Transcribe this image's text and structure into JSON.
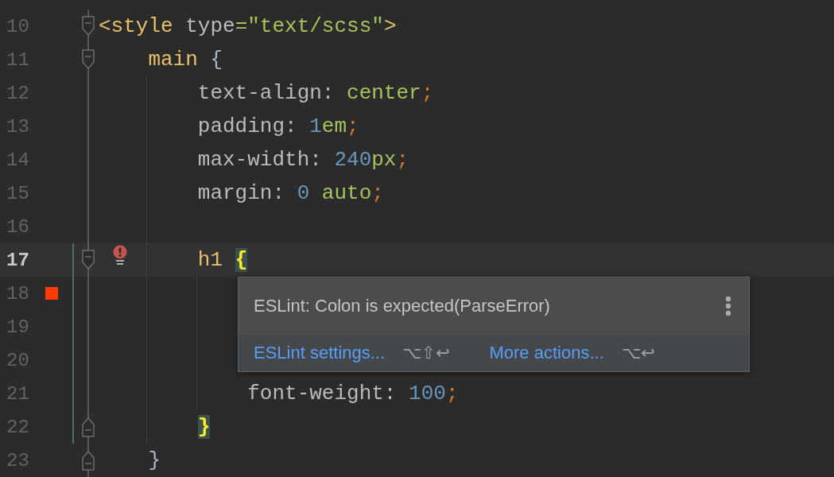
{
  "editor": {
    "lines": [
      {
        "number": "10",
        "fold_start": true,
        "tokens": [
          {
            "text": "<style",
            "kind": "tag"
          },
          {
            "text": " type",
            "kind": "attr"
          },
          {
            "text": "=\"text/scss\"",
            "kind": "string"
          },
          {
            "text": ">",
            "kind": "tag"
          }
        ],
        "children": [
          {
            "number": "11",
            "fold_start": true,
            "tokens": [
              {
                "text": "main",
                "kind": "selector"
              },
              {
                "text": " {",
                "kind": "punct"
              }
            ],
            "children": [
              {
                "number": "12",
                "tokens": [
                  {
                    "text": "text-align: ",
                    "kind": "property"
                  },
                  {
                    "text": "center",
                    "kind": "value"
                  },
                  {
                    "text": ";",
                    "kind": "semicolon"
                  }
                ]
              },
              {
                "number": "13",
                "tokens": [
                  {
                    "text": "padding: ",
                    "kind": "property"
                  },
                  {
                    "text": "1",
                    "kind": "number"
                  },
                  {
                    "text": "em",
                    "kind": "value"
                  },
                  {
                    "text": ";",
                    "kind": "semicolon"
                  }
                ]
              },
              {
                "number": "14",
                "tokens": [
                  {
                    "text": "max-width: ",
                    "kind": "property"
                  },
                  {
                    "text": "240",
                    "kind": "number"
                  },
                  {
                    "text": "px",
                    "kind": "value"
                  },
                  {
                    "text": ";",
                    "kind": "semicolon"
                  }
                ]
              },
              {
                "number": "15",
                "tokens": [
                  {
                    "text": "margin: ",
                    "kind": "property"
                  },
                  {
                    "text": "0",
                    "kind": "number"
                  },
                  {
                    "text": " auto",
                    "kind": "value"
                  },
                  {
                    "text": ";",
                    "kind": "semicolon"
                  }
                ]
              },
              {
                "number": "16"
              },
              {
                "number": "17",
                "fold_start": true,
                "current": true,
                "bulb": true,
                "changed": true,
                "tokens": [
                  {
                    "text": "h1 ",
                    "kind": "selector"
                  },
                  {
                    "text": "{",
                    "kind": "punct",
                    "match": true,
                    "error": true
                  }
                ],
                "children": [
                  {
                    "number": "18",
                    "error_marker": true,
                    "changed": true
                  },
                  {
                    "number": "19",
                    "changed": true
                  },
                  {
                    "number": "20",
                    "changed": true
                  },
                  {
                    "number": "21",
                    "changed": true,
                    "tokens": [
                      {
                        "text": "font-weight: ",
                        "kind": "property"
                      },
                      {
                        "text": "100",
                        "kind": "number"
                      },
                      {
                        "text": ";",
                        "kind": "semicolon"
                      }
                    ]
                  }
                ]
              },
              {
                "number": "22",
                "fold_end": true,
                "changed": true,
                "tokens": [
                  {
                    "text": "}",
                    "kind": "punct",
                    "match": true
                  }
                ]
              }
            ]
          },
          {
            "number": "23",
            "fold_end": true,
            "tokens": [
              {
                "text": "}",
                "kind": "punct"
              }
            ]
          }
        ]
      }
    ]
  },
  "popup": {
    "message": "ESLint: Colon is expected(ParseError)",
    "actions": [
      {
        "label": "ESLint settings...",
        "shortcut": "⌥⇧↩"
      },
      {
        "label": "More actions...",
        "shortcut": "⌥↩"
      }
    ]
  }
}
